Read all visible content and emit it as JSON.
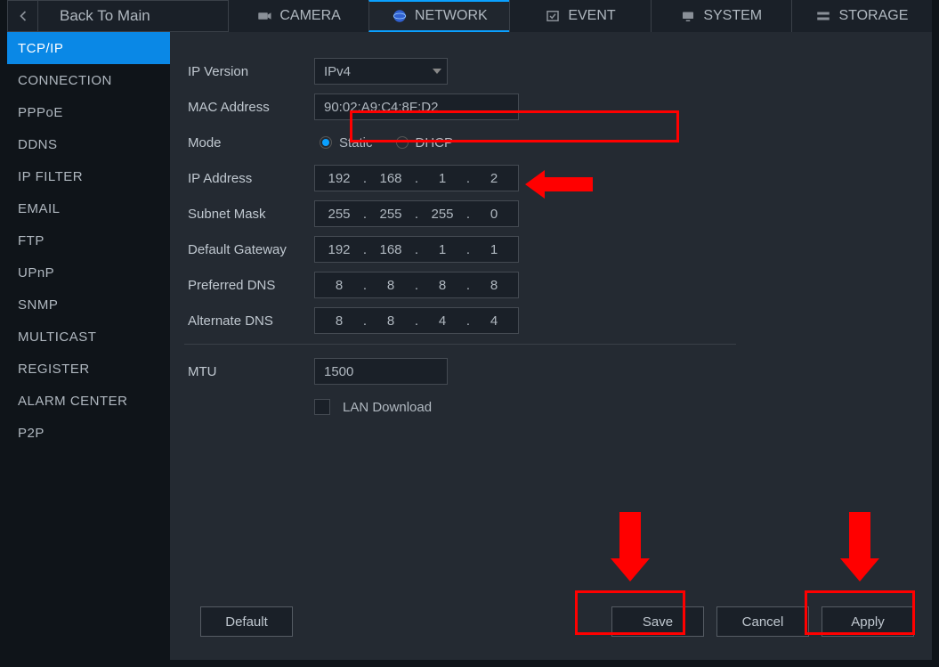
{
  "header": {
    "back_label": "Back To Main",
    "tabs": [
      {
        "label": "CAMERA"
      },
      {
        "label": "NETWORK"
      },
      {
        "label": "EVENT"
      },
      {
        "label": "SYSTEM"
      },
      {
        "label": "STORAGE"
      }
    ]
  },
  "sidebar": {
    "items": [
      "TCP/IP",
      "CONNECTION",
      "PPPoE",
      "DDNS",
      "IP FILTER",
      "EMAIL",
      "FTP",
      "UPnP",
      "SNMP",
      "MULTICAST",
      "REGISTER",
      "ALARM CENTER",
      "P2P"
    ]
  },
  "form": {
    "ip_version_label": "IP Version",
    "ip_version_value": "IPv4",
    "mac_label": "MAC Address",
    "mac_value": "90:02:A9:C4:8F:D2",
    "mode_label": "Mode",
    "mode_static": "Static",
    "mode_dhcp": "DHCP",
    "ip_label": "IP Address",
    "ip": [
      "192",
      "168",
      "1",
      "2"
    ],
    "subnet_label": "Subnet Mask",
    "subnet": [
      "255",
      "255",
      "255",
      "0"
    ],
    "gateway_label": "Default Gateway",
    "gateway": [
      "192",
      "168",
      "1",
      "1"
    ],
    "dns1_label": "Preferred DNS",
    "dns1": [
      "8",
      "8",
      "8",
      "8"
    ],
    "dns2_label": "Alternate DNS",
    "dns2": [
      "8",
      "8",
      "4",
      "4"
    ],
    "mtu_label": "MTU",
    "mtu_value": "1500",
    "lan_label": "LAN Download"
  },
  "buttons": {
    "default": "Default",
    "save": "Save",
    "cancel": "Cancel",
    "apply": "Apply"
  }
}
